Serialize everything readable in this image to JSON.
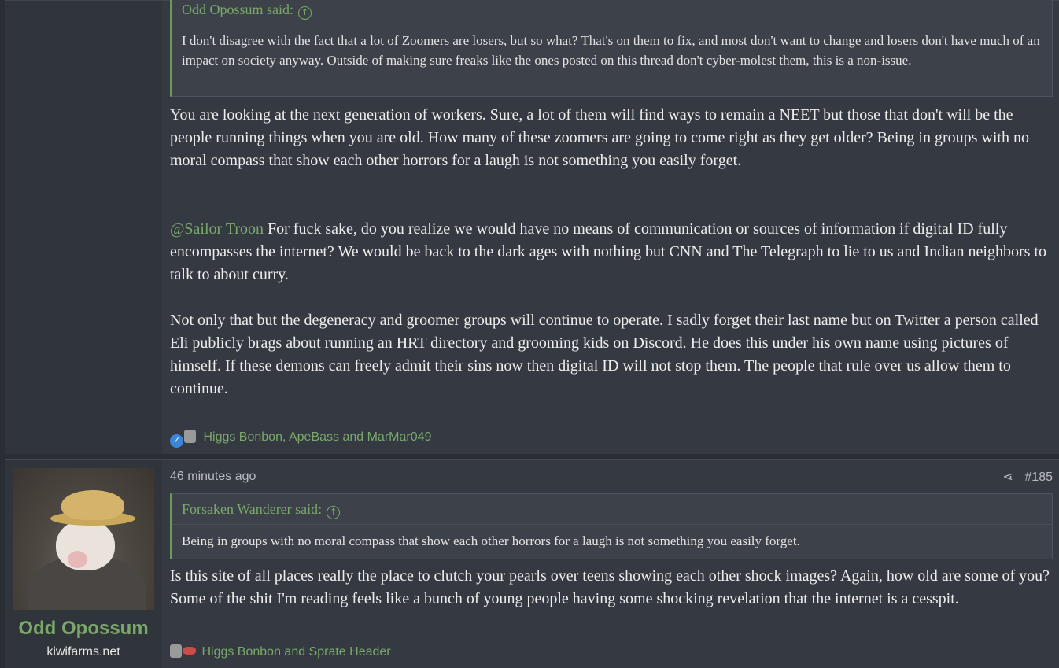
{
  "post1": {
    "quote": {
      "author": "Odd Opossum said:",
      "text": "I don't disagree with the fact that a lot of Zoomers are losers, but so what? That's on them to fix, and most don't want to change and losers don't have much of an impact on society anyway. Outside of making sure freaks like the ones posted on this thread don't cyber-molest them, this is a non-issue."
    },
    "para1": "You are looking at the next generation of workers. Sure, a lot of them will find ways to remain a NEET but those that don't will be the people running things when you are old. How many of these zoomers are going to come right as they get older? Being in groups with no moral compass that show each other horrors for a laugh is not something you easily forget.",
    "mention": "@Sailor Troon",
    "para2": " For fuck sake, do you realize we would have no means of communication or sources of information if digital ID fully encompasses the internet? We would be back to the dark ages with nothing but CNN and The Telegraph to lie to us and Indian neighbors to talk to about curry.",
    "para3": "Not only that but the degeneracy and groomer groups will continue to operate. I sadly forget their last name but on Twitter a person called Eli publicly brags about running an HRT directory and grooming kids on Discord. He does this under his own name using pictures of himself. If these demons can freely admit their sins now then digital ID will not stop them. The people that rule over us allow them to continue.",
    "reactions": "Higgs Bonbon, ApeBass and MarMar049"
  },
  "post2": {
    "username": "Odd Opossum",
    "user_title": "kiwifarms.net",
    "timestamp": "46 minutes ago",
    "post_number": "#185",
    "quote": {
      "author": "Forsaken Wanderer said:",
      "text": "Being in groups with no moral compass that show each other horrors for a laugh is not something you easily forget."
    },
    "para1": "Is this site of all places really the place to clutch your pearls over teens showing each other shock images? Again, how old are some of you? Some of the shit I'm reading feels like a bunch of young people having some shocking revelation that the internet is a cesspit.",
    "reactions": "Higgs Bonbon and Sprate Header"
  },
  "icons": {
    "quote_arrow": "↑",
    "share": "⋖",
    "like": "👍"
  },
  "colors": {
    "accent": "#7aa86a",
    "post_bg": "#353a42",
    "page_bg": "#2a2d33"
  }
}
